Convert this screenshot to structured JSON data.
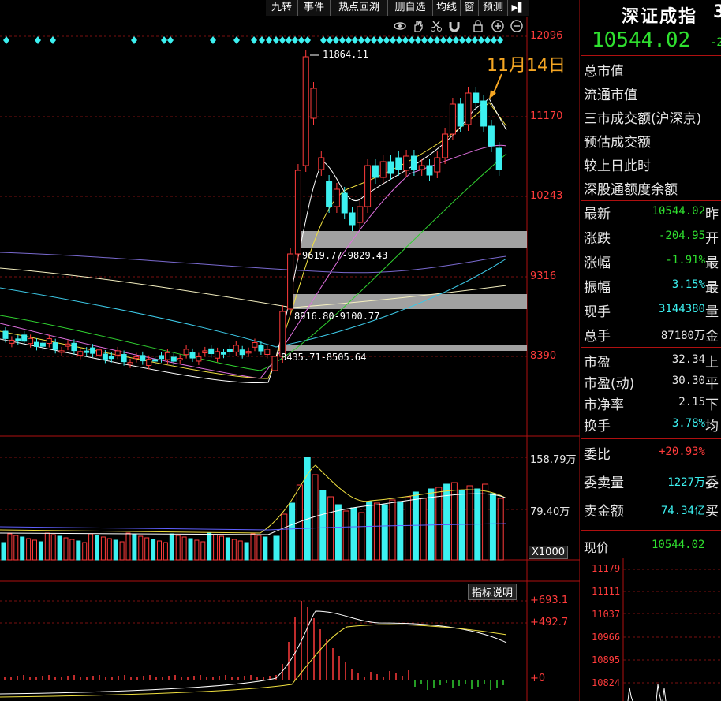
{
  "toolbar": {
    "items": [
      "九转",
      "事件",
      "热点回溯",
      "删自选",
      "均线",
      "窗",
      "预测"
    ],
    "arrow_glyph": "▶▌"
  },
  "chart_tools": [
    "eye-icon",
    "hand-icon",
    "scissors-icon",
    "magnet-icon",
    "lock-icon",
    "zoom-in-icon",
    "zoom-out-icon"
  ],
  "main_chart": {
    "price_axis": [
      "12096",
      "11170",
      "10243",
      "9316",
      "8390"
    ],
    "high_label": "11864.11",
    "annotation": "11月14日",
    "gaps": [
      "9619.77-9829.43",
      "8916.80-9100.77",
      "8435.71-8505.64"
    ]
  },
  "volume_chart": {
    "axis": [
      "158.79万",
      "79.40万"
    ],
    "unit": "X1000"
  },
  "macd_chart": {
    "button": "指标说明",
    "axis": [
      "+693.1",
      "+492.7",
      "+0"
    ]
  },
  "sidebar": {
    "title": "深证成指",
    "price": "10544.02",
    "price_change_fragment": "-2",
    "info_rows": [
      "总市值",
      "流通市值",
      "三市成交额(沪深京)",
      "预估成交额",
      "较上日此时",
      "深股通额度余额"
    ],
    "quotes": [
      {
        "label": "最新",
        "value": "10544.02",
        "tail": "昨",
        "color": "green"
      },
      {
        "label": "涨跌",
        "value": "-204.95",
        "tail": "开",
        "color": "green"
      },
      {
        "label": "涨幅",
        "value": "-1.91%",
        "tail": "最",
        "color": "green"
      },
      {
        "label": "振幅",
        "value": "3.15%",
        "tail": "最",
        "color": "cyan"
      },
      {
        "label": "现手",
        "value": "3144380",
        "tail": "量",
        "color": "cyan"
      },
      {
        "label": "总手",
        "value": "87180万",
        "tail": "金",
        "color": "white"
      }
    ],
    "valuation": [
      {
        "label": "市盈",
        "value": "32.34",
        "tail": "上"
      },
      {
        "label": "市盈(动)",
        "value": "30.30",
        "tail": "平"
      },
      {
        "label": "市净率",
        "value": "2.15",
        "tail": "下"
      },
      {
        "label": "换手",
        "value": "3.78%",
        "tail": "均",
        "color": "cyan"
      }
    ],
    "orders": [
      {
        "label": "委比",
        "value": "+20.93%",
        "tail": "",
        "color": "red"
      },
      {
        "label": "委卖量",
        "value": "1227万",
        "tail": "委",
        "color": "cyan"
      },
      {
        "label": "卖金额",
        "value": "74.34亿",
        "tail": "买",
        "color": "cyan"
      }
    ],
    "current_price_label": "现价",
    "current_price_value": "10544.02",
    "mini_axis": [
      "11179",
      "11111",
      "11037",
      "10966",
      "10895",
      "10824"
    ]
  },
  "colors": {
    "up": "#ff3b3b",
    "down": "#3cf0f0",
    "ma5": "#ffffff",
    "ma10": "#f0e040",
    "ma20": "#e070e0",
    "ma60": "#30d030",
    "annotation": "#f5a623"
  }
}
